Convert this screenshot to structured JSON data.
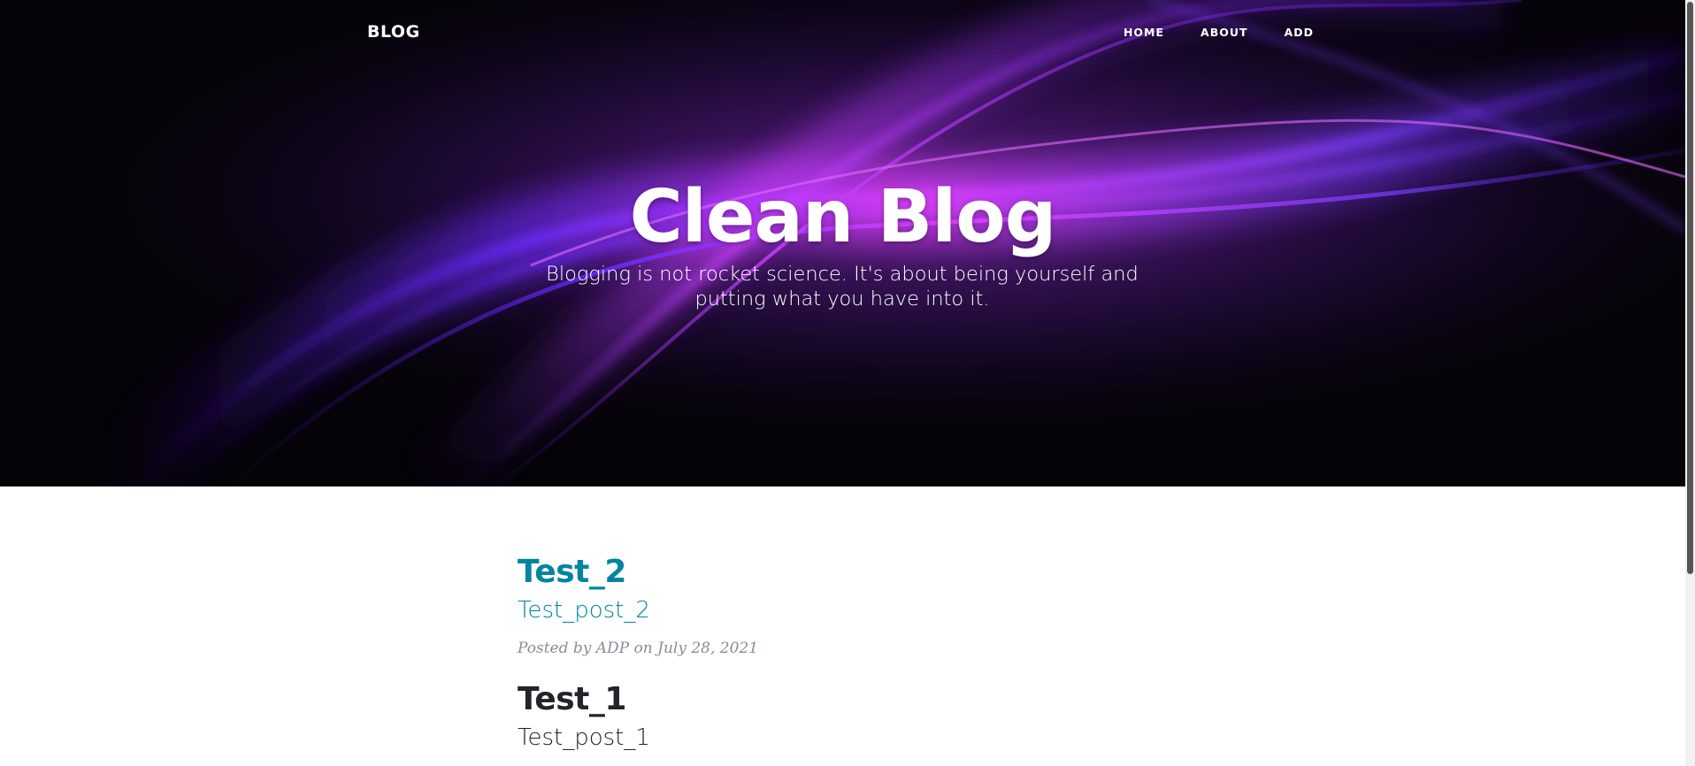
{
  "nav": {
    "brand": "BLOG",
    "links": [
      "HOME",
      "ABOUT",
      "ADD"
    ]
  },
  "hero": {
    "title": "Clean Blog",
    "subtitle": "Blogging is not rocket science. It's about being yourself and putting what you have into it."
  },
  "posts": [
    {
      "title": "Test_2",
      "subtitle": "Test_post_2",
      "meta_prefix": "Posted by",
      "author": "ADP",
      "meta_on": "on",
      "date": "July 28, 2021"
    },
    {
      "title": "Test_1",
      "subtitle": "Test_post_1"
    }
  ],
  "colors": {
    "accent": "#0085a1",
    "text": "#212529",
    "meta": "#868e96",
    "hero_bg": "#050308",
    "purple": "#a020f0",
    "magenta": "#d63cff"
  }
}
